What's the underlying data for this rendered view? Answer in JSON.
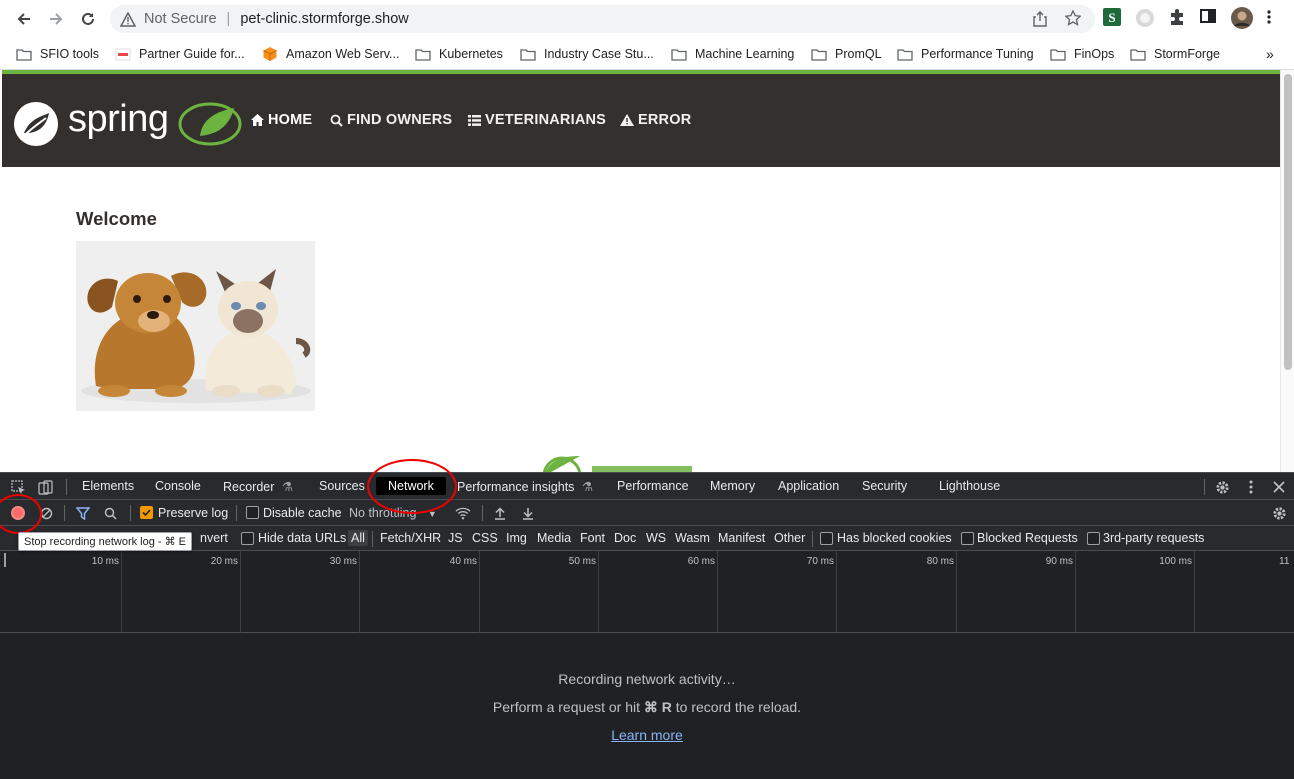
{
  "browser": {
    "security_label": "Not Secure",
    "url": "pet-clinic.stormforge.show",
    "bookmarks": [
      {
        "label": "SFIO tools",
        "icon": "folder-icon"
      },
      {
        "label": "Partner Guide for...",
        "icon": "partner-favicon"
      },
      {
        "label": "Amazon Web Serv...",
        "icon": "aws-favicon"
      },
      {
        "label": "Kubernetes",
        "icon": "folder-icon"
      },
      {
        "label": "Industry Case Stu...",
        "icon": "folder-icon"
      },
      {
        "label": "Machine Learning",
        "icon": "folder-icon"
      },
      {
        "label": "PromQL",
        "icon": "folder-icon"
      },
      {
        "label": "Performance Tuning",
        "icon": "folder-icon"
      },
      {
        "label": "FinOps",
        "icon": "folder-icon"
      },
      {
        "label": "StormForge",
        "icon": "folder-icon"
      }
    ],
    "more_bookmarks": "»"
  },
  "site": {
    "logo_text": "spring",
    "nav": [
      {
        "label": "HOME",
        "icon": "home-icon"
      },
      {
        "label": "FIND OWNERS",
        "icon": "search-icon"
      },
      {
        "label": "VETERINARIANS",
        "icon": "list-icon"
      },
      {
        "label": "ERROR",
        "icon": "warning-icon"
      }
    ],
    "heading": "Welcome",
    "colors": {
      "navbar": "#34302d",
      "accent": "#6db33f"
    }
  },
  "devtools": {
    "tabs": [
      "Elements",
      "Console",
      "Recorder",
      "Sources",
      "Network",
      "Performance insights",
      "Performance",
      "Memory",
      "Application",
      "Security",
      "Lighthouse"
    ],
    "active_tab": "Network",
    "toolbar": {
      "preserve_log": "Preserve log",
      "disable_cache": "Disable cache",
      "throttling": "No throttling"
    },
    "filter_bar": {
      "invert": "nvert",
      "hide_data_urls": "Hide data URLs",
      "types": [
        "All",
        "Fetch/XHR",
        "JS",
        "CSS",
        "Img",
        "Media",
        "Font",
        "Doc",
        "WS",
        "Wasm",
        "Manifest",
        "Other"
      ],
      "has_blocked_cookies": "Has blocked cookies",
      "blocked_requests": "Blocked Requests",
      "third_party": "3rd-party requests"
    },
    "tooltip": "Stop recording network log - ⌘ E",
    "timeline_ticks": [
      "10 ms",
      "20 ms",
      "30 ms",
      "40 ms",
      "50 ms",
      "60 ms",
      "70 ms",
      "80 ms",
      "90 ms",
      "100 ms",
      "11"
    ],
    "empty": {
      "line1": "Recording network activity…",
      "line2_pre": "Perform a request or hit ",
      "line2_key": "⌘ R",
      "line2_post": " to record the reload.",
      "learn_more": "Learn more"
    }
  }
}
